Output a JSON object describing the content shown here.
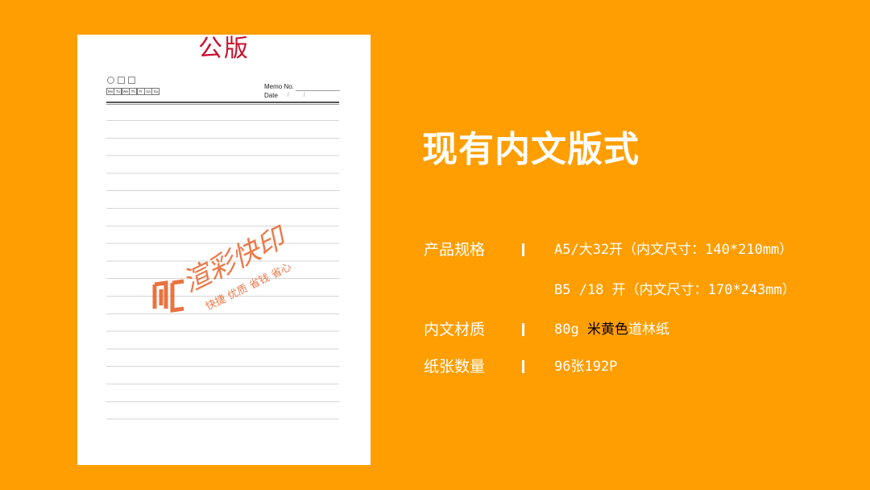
{
  "paper": {
    "title": "公版",
    "days": [
      "Mo",
      "Tu",
      "We",
      "Th",
      "Fr",
      "Sa",
      "Su"
    ],
    "memo_label": "Memo No.",
    "date_label": "Date",
    "date_slashes": "/ /"
  },
  "watermark": {
    "brand": "渲彩快印",
    "slogan": "快捷 优质 省钱 省心",
    "color": "#E8642C"
  },
  "title": "现有内文版式",
  "specs": [
    {
      "label": "产品规格",
      "value": "A5/大32开（内文尺寸：140*210mm）"
    },
    {
      "label": "",
      "value": "B5 /18 开（内文尺寸：170*243mm）"
    },
    {
      "label": "内文材质",
      "value_prefix": "80g ",
      "value_highlight": "米黄色",
      "value_suffix": "道林纸"
    },
    {
      "label": "纸张数量",
      "value": "96张192P"
    }
  ],
  "colors": {
    "background": "#FF9E00",
    "paper": "#FFFFFF",
    "title_red": "#C8102E"
  }
}
